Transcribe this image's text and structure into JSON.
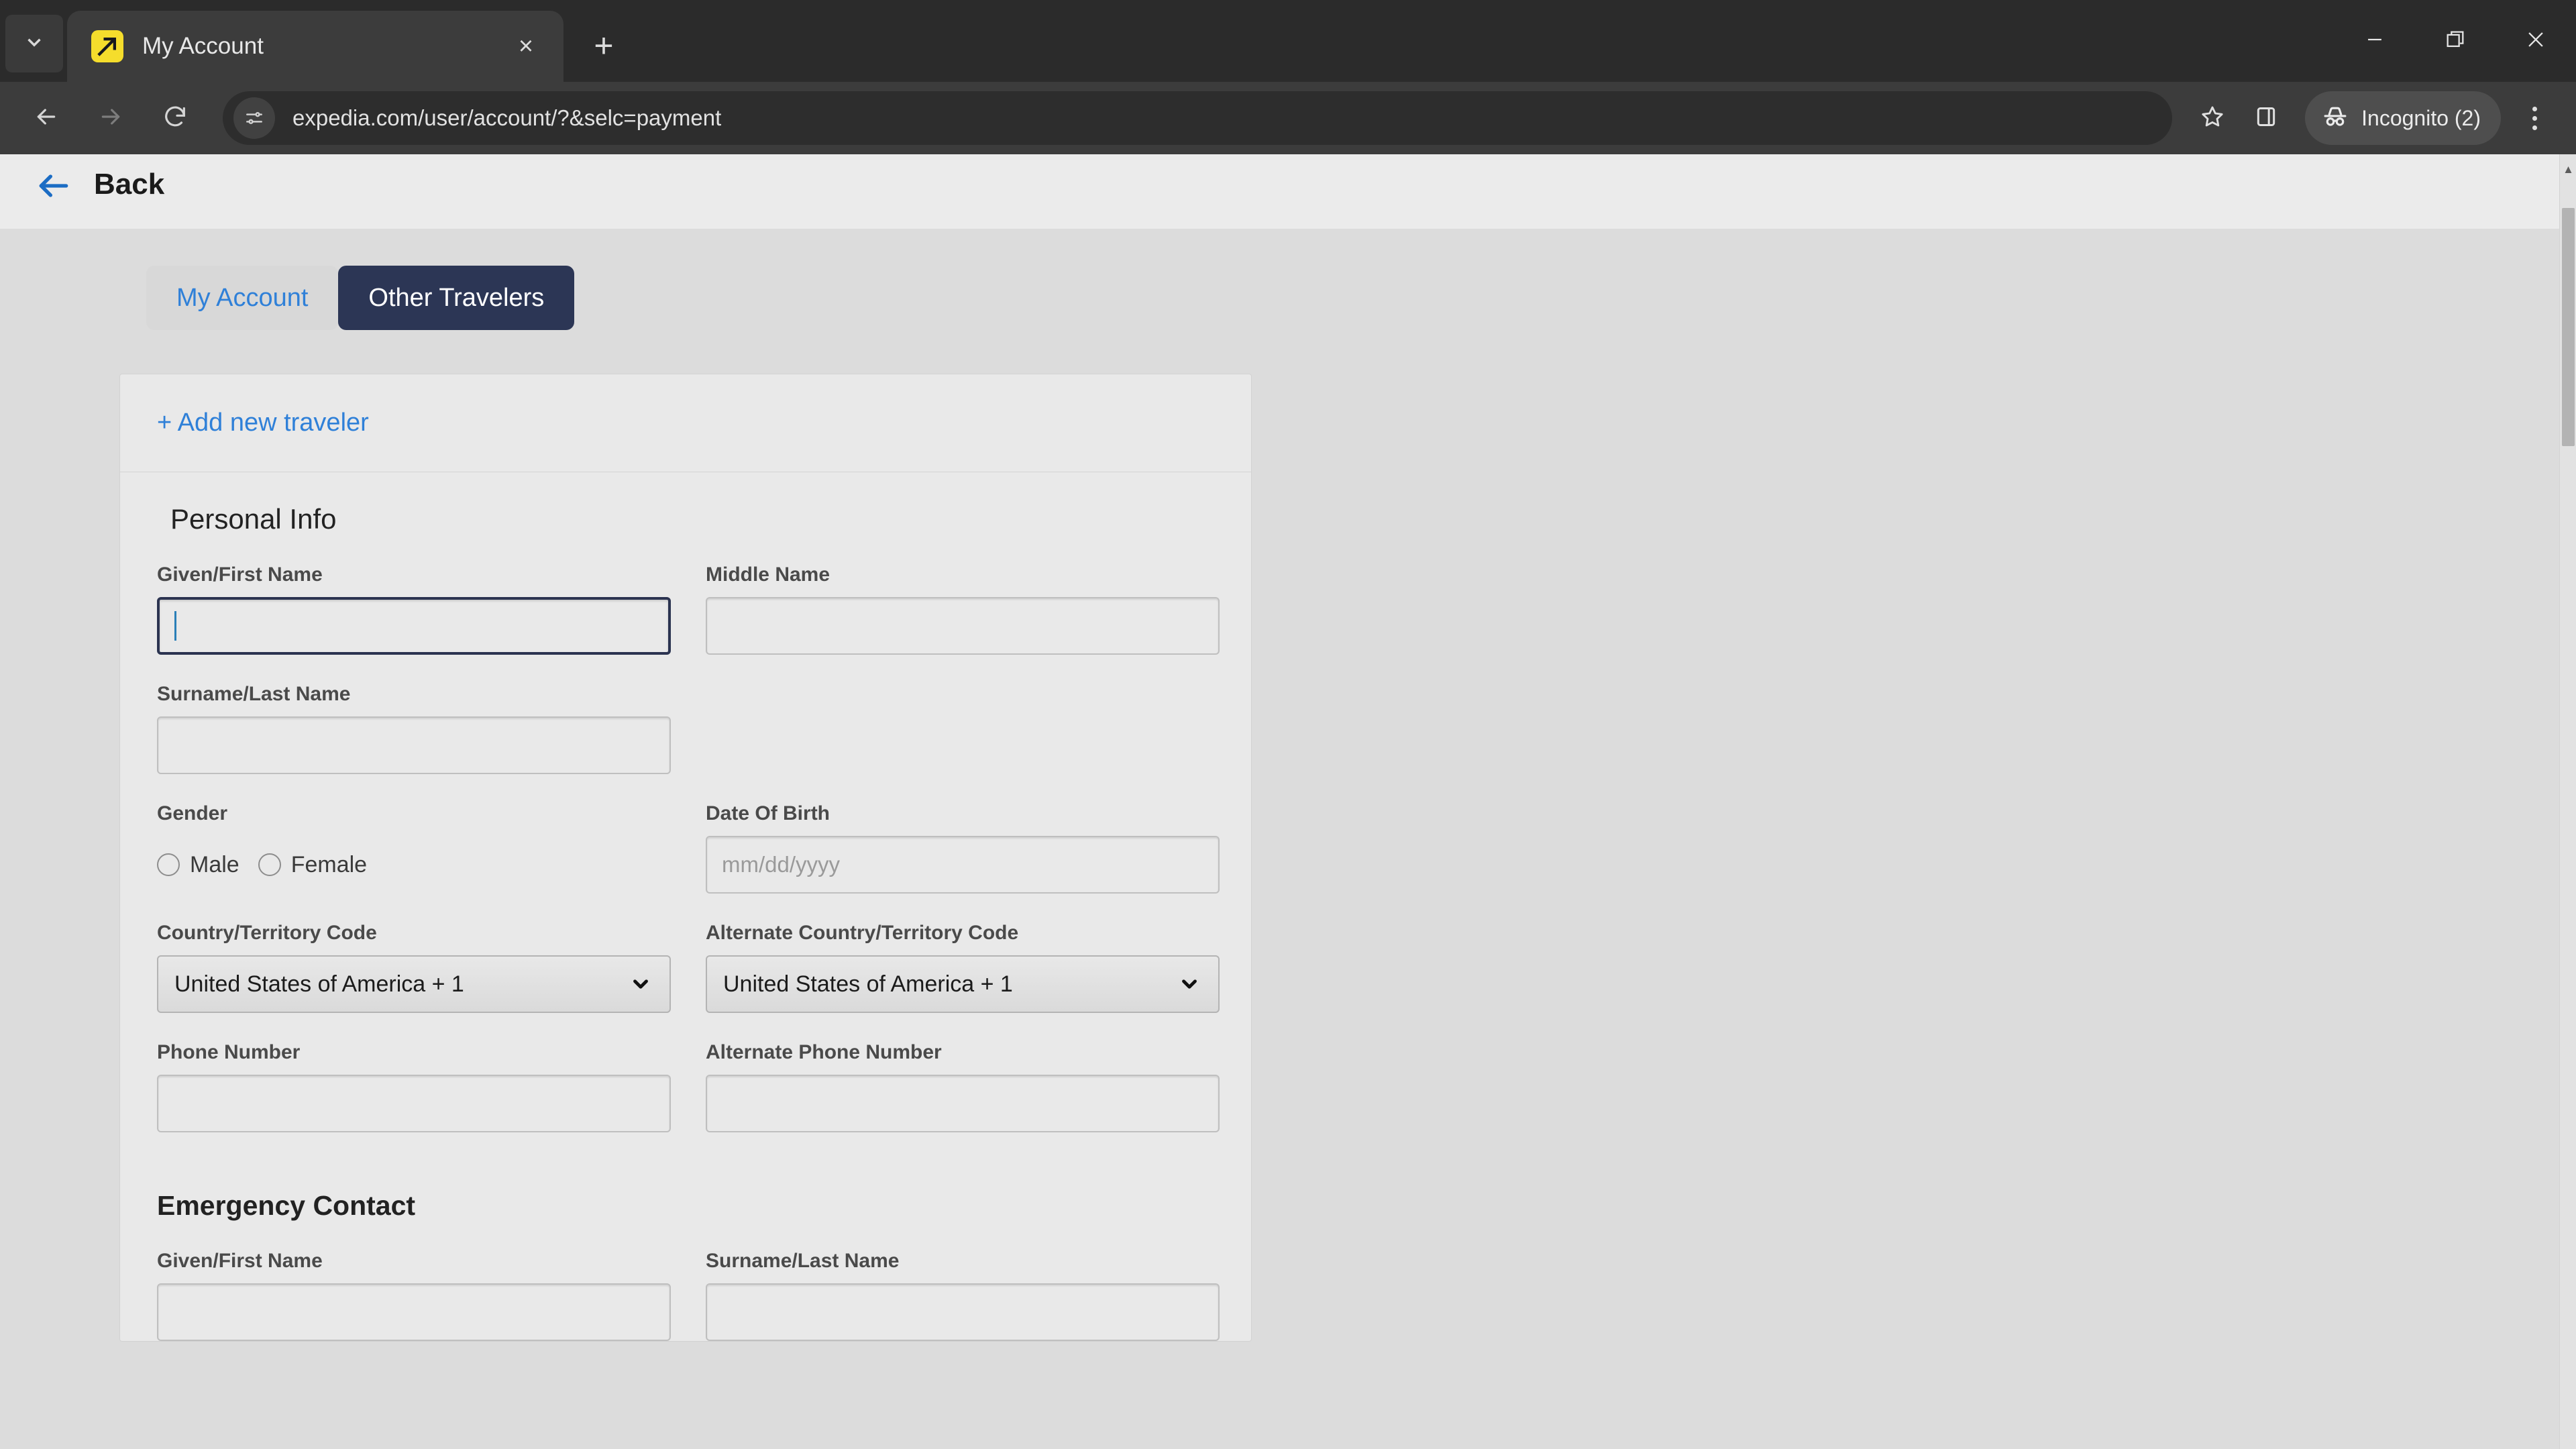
{
  "browser": {
    "tab": {
      "title": "My Account",
      "favicon": "expedia-arrow-icon",
      "close": "×"
    },
    "new_tab": "+",
    "window_controls": {
      "minimize": "minimize-icon",
      "maximize": "maximize-icon",
      "close": "close-icon"
    },
    "toolbar": {
      "back": "back-icon",
      "forward": "forward-icon",
      "reload": "reload-icon",
      "site_info": "site-settings-icon",
      "url": "expedia.com/user/account/?&selc=payment",
      "bookmark": "star-icon",
      "side_panel": "side-panel-icon",
      "profile_label": "Incognito (2)",
      "menu": "kebab-menu-icon"
    }
  },
  "page": {
    "back_link": "Back",
    "tabs": [
      {
        "label": "My Account",
        "active": false
      },
      {
        "label": "Other Travelers",
        "active": true
      }
    ],
    "card": {
      "add_traveler_link": "+ Add new traveler",
      "personal_info": {
        "heading": "Personal Info",
        "fields": {
          "given_name": {
            "label": "Given/First Name",
            "value": "",
            "placeholder": "",
            "focused": true
          },
          "middle_name": {
            "label": "Middle Name",
            "value": "",
            "placeholder": ""
          },
          "surname": {
            "label": "Surname/Last Name",
            "value": "",
            "placeholder": ""
          },
          "gender": {
            "label": "Gender",
            "options": [
              {
                "label": "Male",
                "selected": false
              },
              {
                "label": "Female",
                "selected": false
              }
            ]
          },
          "dob": {
            "label": "Date Of Birth",
            "value": "",
            "placeholder": "mm/dd/yyyy"
          },
          "country_code": {
            "label": "Country/Territory Code",
            "value": "United States of America + 1"
          },
          "alt_country_code": {
            "label": "Alternate Country/Territory Code",
            "value": "United States of America + 1"
          },
          "phone": {
            "label": "Phone Number",
            "value": "",
            "placeholder": ""
          },
          "alt_phone": {
            "label": "Alternate Phone Number",
            "value": "",
            "placeholder": ""
          }
        }
      },
      "emergency_contact": {
        "heading": "Emergency Contact",
        "fields": {
          "given_name": {
            "label": "Given/First Name",
            "value": "",
            "placeholder": ""
          },
          "surname": {
            "label": "Surname/Last Name",
            "value": "",
            "placeholder": ""
          }
        }
      }
    }
  },
  "colors": {
    "accent_link": "#2f80d8",
    "active_tab_bg": "#2c3655",
    "focus_border": "#2b3350",
    "page_bg": "#dcdcdc",
    "card_bg": "#e9e9e9",
    "favicon_yellow": "#f5dd2c"
  }
}
